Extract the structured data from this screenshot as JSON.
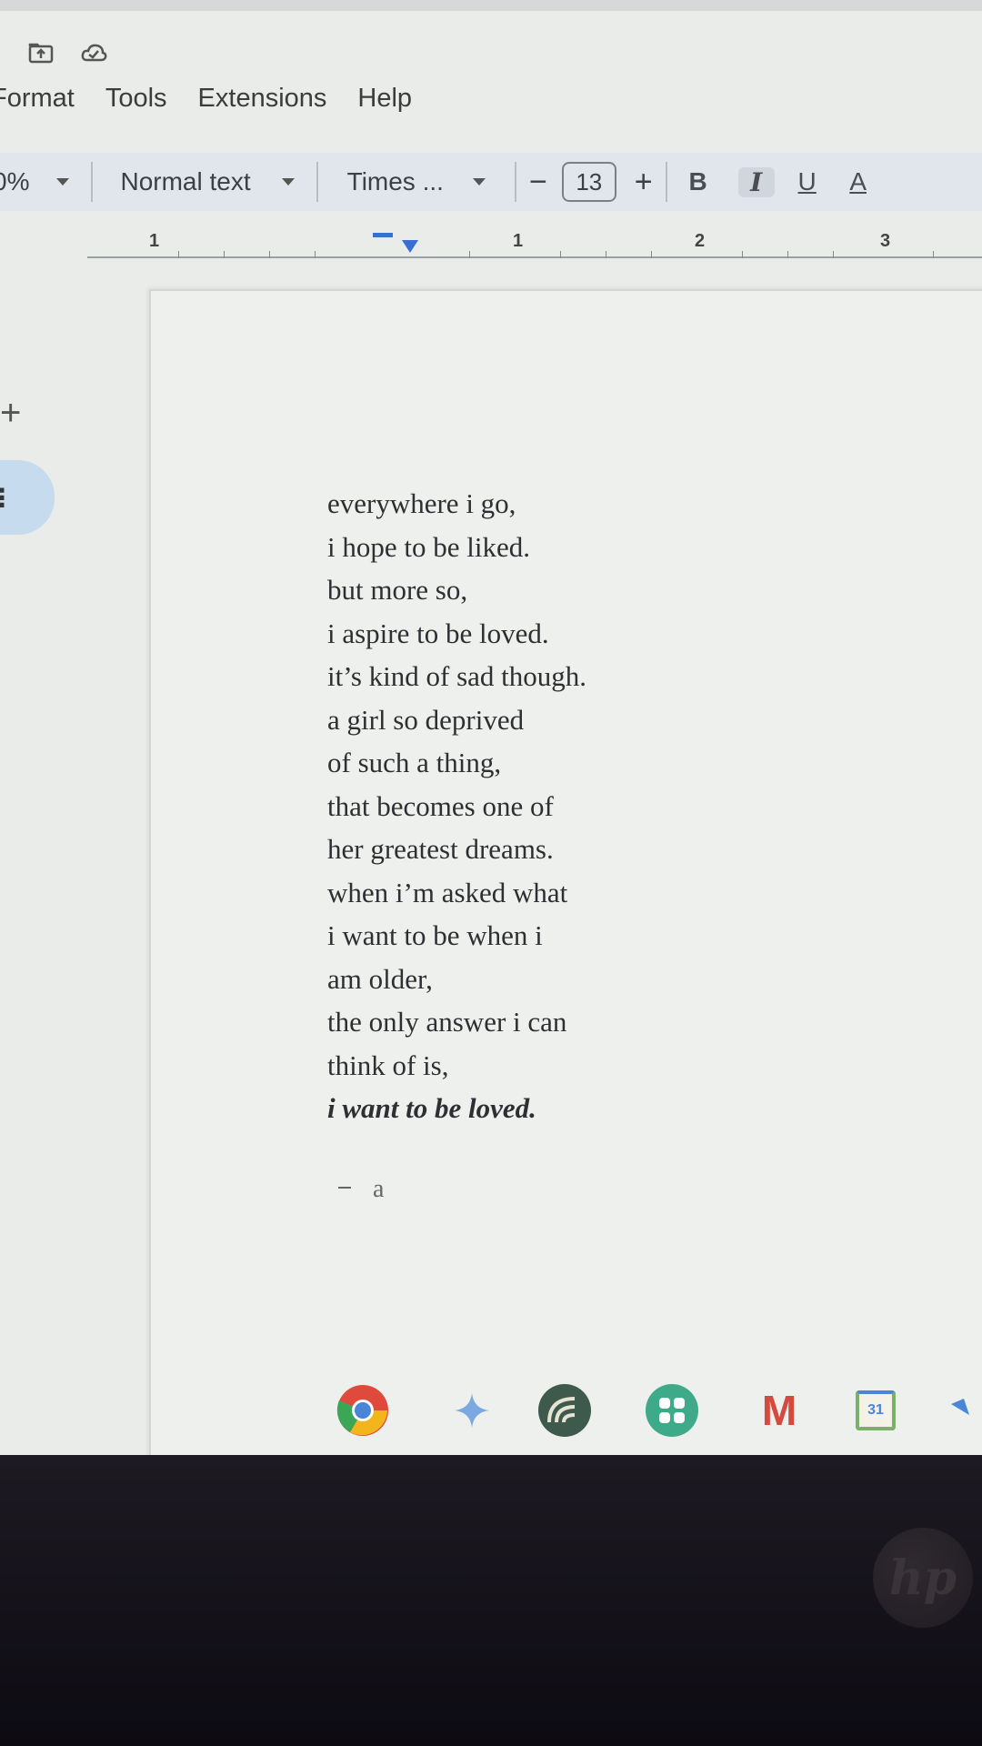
{
  "menu": {
    "items": [
      "Format",
      "Tools",
      "Extensions",
      "Help"
    ]
  },
  "toolbar": {
    "zoom_value": "0%",
    "style_value": "Normal text",
    "font_value": "Times ...",
    "font_size": "13",
    "bold_label": "B",
    "italic_label": "I",
    "underline_label": "U",
    "text_color_label": "A",
    "decrease_label": "−",
    "increase_label": "+"
  },
  "ruler": {
    "labels": [
      "1",
      "1",
      "2",
      "3"
    ]
  },
  "sidebar": {
    "add_label": "+",
    "outline_label": "⋮"
  },
  "document": {
    "lines": [
      "everywhere i go,",
      "i hope to be liked.",
      "but more so,",
      "i aspire to be loved.",
      "it’s kind of sad though.",
      "a girl so deprived",
      "of such a thing,",
      "that becomes one of",
      "her greatest dreams.",
      "when i’m asked what",
      "i want to be when i",
      "am older,",
      "the only answer i can",
      "think of is,",
      "i want to be loved."
    ],
    "signature": "a"
  },
  "taskbar": {
    "apps": [
      "chrome-icon",
      "gemini-icon",
      "camera-app-icon",
      "launcher-icon",
      "gmail-icon",
      "calendar-icon",
      "files-icon"
    ],
    "calendar_day": "31",
    "gmail_letter": "M"
  },
  "device": {
    "logo_text": "hp"
  },
  "colors": {
    "toolbar_bg": "#e1e6ec",
    "page_bg": "#eef0ed",
    "accent_blue": "#3a6ed1",
    "outline_pill": "#c7dbee"
  }
}
